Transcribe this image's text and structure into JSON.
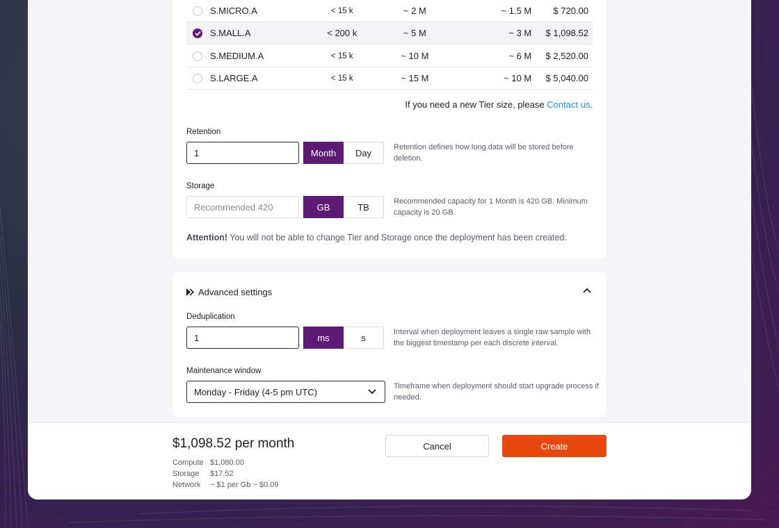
{
  "tiers": {
    "rows": [
      {
        "name": "S.MICRO.A",
        "col_a": "< 15 k",
        "col_b": "~ 2 M",
        "col_c": "~ 1.5 M",
        "price": "$ 720.00",
        "selected": false
      },
      {
        "name": "S.MALL.A",
        "col_a": "< 200 k",
        "col_b": "~ 5 M",
        "col_c": "~ 3 M",
        "price": "$ 1,098.52",
        "selected": true
      },
      {
        "name": "S.MEDIUM.A",
        "col_a": "< 15 k",
        "col_b": "~ 10 M",
        "col_c": "~ 6 M",
        "price": "$ 2,520.00",
        "selected": false
      },
      {
        "name": "S.LARGE.A",
        "col_a": "< 15 k",
        "col_b": "~ 15 M",
        "col_c": "~ 10 M",
        "price": "$ 5,040.00",
        "selected": false
      }
    ],
    "note_prefix": "If you need a new Tier size, please ",
    "note_link": "Contact us",
    "note_suffix": "."
  },
  "retention": {
    "label": "Retention",
    "value": "1",
    "units": [
      "Month",
      "Day"
    ],
    "selected_unit": "Month",
    "help": "Retention defines how long data will be stored before deletion."
  },
  "storage": {
    "label": "Storage",
    "placeholder": "Recommended 420",
    "units": [
      "GB",
      "TB"
    ],
    "selected_unit": "GB",
    "help": "Recommended capacity for 1 Month is 420 GB. Minimum capacity is 20 GB."
  },
  "attention": {
    "strong": "Attention!",
    "text": " You will not be able to change Tier and Storage once the deployment has been created."
  },
  "advanced": {
    "title": "Advanced settings",
    "deduplication": {
      "label": "Deduplication",
      "value": "1",
      "units": [
        "ms",
        "s"
      ],
      "selected_unit": "ms",
      "help": "Interval when deployment leaves a single raw sample with the biggest timestamp per each discrete interval."
    },
    "maintenance": {
      "label": "Maintenance window",
      "value": "Monday - Friday (4-5 pm UTC)",
      "help": "Timeframe when deployment should start upgrade process if needed."
    }
  },
  "footer": {
    "price": "$1,098.52 per month",
    "breakdown": [
      {
        "key": "Compute",
        "value": "$1,080.00"
      },
      {
        "key": "Storage",
        "value": "$17.52"
      },
      {
        "key": "Network",
        "value": "~ $1  per Gb ~ $0.09"
      }
    ],
    "cancel_label": "Cancel",
    "create_label": "Create"
  },
  "colors": {
    "accent": "#5e1b73",
    "create": "#e8480c",
    "link": "#1d8fd9"
  }
}
